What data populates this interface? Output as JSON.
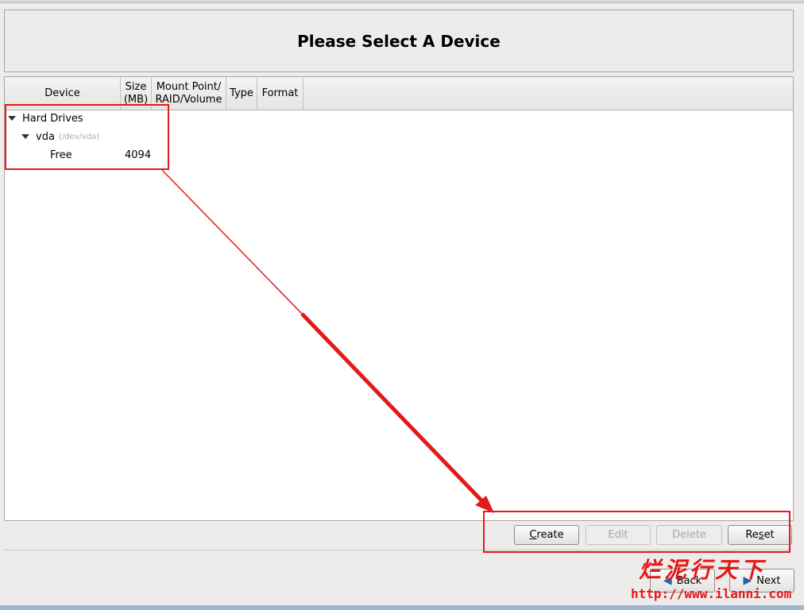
{
  "title": "Please Select A Device",
  "columns": {
    "device": "Device",
    "size_line1": "Size",
    "size_line2": "(MB)",
    "mount_line1": "Mount Point/",
    "mount_line2": "RAID/Volume",
    "type": "Type",
    "format": "Format"
  },
  "tree": {
    "group": "Hard Drives",
    "disk": "vda",
    "disk_path": "(/dev/vda)",
    "free_label": "Free",
    "free_size": "4094"
  },
  "buttons": {
    "create_mnemonic": "C",
    "create_rest": "reate",
    "edit": "Edit",
    "delete": "Delete",
    "reset_pre": "Re",
    "reset_mnemonic": "s",
    "reset_post": "et"
  },
  "nav": {
    "back": "Back",
    "next": "Next"
  },
  "watermark": {
    "cn": "烂泥行天下",
    "url": "http://www.ilanni.com"
  },
  "colors": {
    "annotation_red": "#e41a1a"
  }
}
